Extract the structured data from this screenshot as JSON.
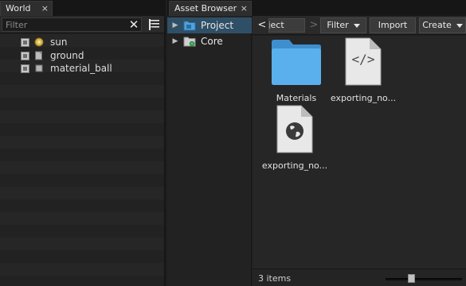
{
  "world": {
    "tab_label": "World",
    "close_glyph": "×",
    "filter": {
      "placeholder": "Filter",
      "value": ""
    },
    "clear_glyph": "✕",
    "nodes": [
      {
        "label": "sun",
        "icon": "sun-icon",
        "enabled": true
      },
      {
        "label": "ground",
        "icon": "mesh-icon",
        "enabled": true
      },
      {
        "label": "material_ball",
        "icon": "mesh-icon",
        "enabled": true
      }
    ]
  },
  "asset_browser": {
    "tab_label": "Asset Browser",
    "close_glyph": "×",
    "tree": [
      {
        "label": "Project",
        "icon": "project-folder-icon",
        "selected": true
      },
      {
        "label": "Core",
        "icon": "core-folder-icon",
        "selected": false
      }
    ],
    "toolbar": {
      "back_glyph": "<",
      "forward_glyph": ">",
      "breadcrumb": "Project",
      "filter_label": "Filter",
      "import_label": "Import",
      "create_label": "Create"
    },
    "items": [
      {
        "label": "Materials",
        "icon": "folder-icon"
      },
      {
        "label": "exporting_no...",
        "icon": "code-file-icon"
      },
      {
        "label": "exporting_no...",
        "icon": "world-file-icon"
      }
    ],
    "status": {
      "count_text": "3 items",
      "zoom_fraction": 0.34
    }
  },
  "colors": {
    "selection": "#2f4f66",
    "folder_blue": "#4fa3e0",
    "panel_bg": "#202020"
  }
}
